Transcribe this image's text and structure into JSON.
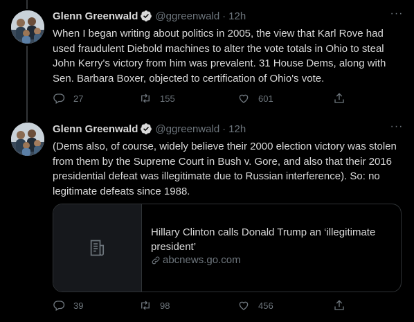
{
  "tweets": [
    {
      "author": {
        "name": "Glenn Greenwald",
        "handle": "@ggreenwald",
        "verified": true
      },
      "time": "12h",
      "dot": "·",
      "text": "When I began writing about politics in 2005, the view that Karl Rove had used fraudulent Diebold machines to alter the vote totals in Ohio to steal John Kerry's victory from him was prevalent. 31 House Dems, along with Sen. Barbara Boxer, objected to certification of Ohio's vote.",
      "replies": "27",
      "retweets": "155",
      "likes": "601"
    },
    {
      "author": {
        "name": "Glenn Greenwald",
        "handle": "@ggreenwald",
        "verified": true
      },
      "time": "12h",
      "dot": "·",
      "text": "(Dems also, of course, widely believe their 2000 election victory was stolen from them by the Supreme Court in Bush v. Gore, and also that their 2016 presidential defeat was illegitimate due to Russian interference). So: no legitimate defeats since 1988.",
      "card": {
        "title": "Hillary Clinton calls Donald Trump an ‘illegitimate president’",
        "domain": "abcnews.go.com",
        "thumb_icon": "article-icon"
      },
      "replies": "39",
      "retweets": "98",
      "likes": "456"
    }
  ],
  "colors": {
    "background": "#000000",
    "text": "#d9d9d9",
    "muted": "#6e767d",
    "verified": "#1d9bf0",
    "border": "#2f3336"
  }
}
